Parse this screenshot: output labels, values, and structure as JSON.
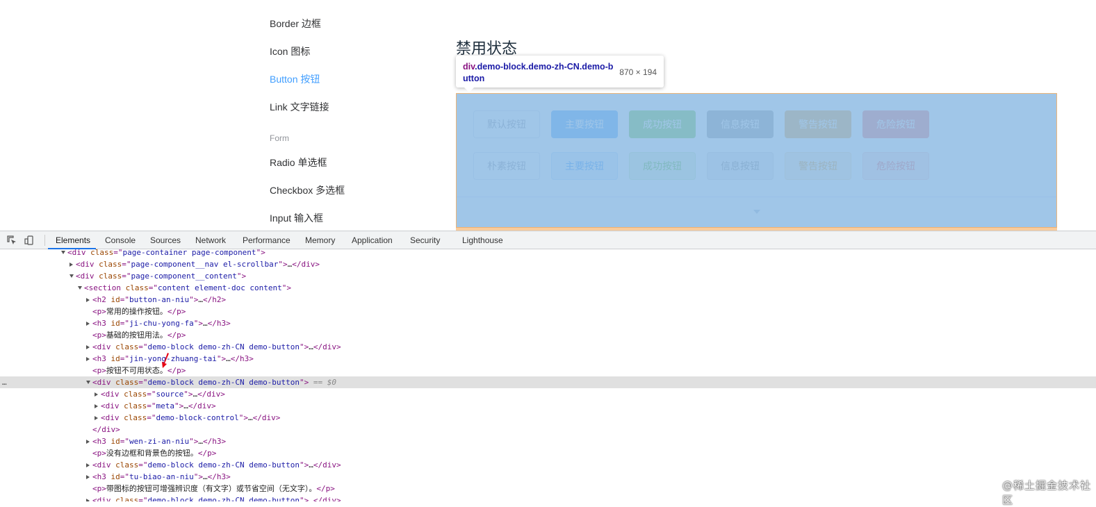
{
  "sidebar": {
    "items": [
      {
        "label": "Border 边框",
        "active": false
      },
      {
        "label": "Icon 图标",
        "active": false
      },
      {
        "label": "Button 按钮",
        "active": true
      },
      {
        "label": "Link 文字链接",
        "active": false
      }
    ],
    "group_title": "Form",
    "form_items": [
      {
        "label": "Radio 单选框"
      },
      {
        "label": "Checkbox 多选框"
      },
      {
        "label": "Input 输入框"
      }
    ]
  },
  "main": {
    "section_title": "禁用状态",
    "buttons_row1": [
      "默认按钮",
      "主要按钮",
      "成功按钮",
      "信息按钮",
      "警告按钮",
      "危险按钮"
    ],
    "buttons_row2": [
      "朴素按钮",
      "主要按钮",
      "成功按钮",
      "信息按钮",
      "警告按钮",
      "危险按钮"
    ]
  },
  "inspect_tooltip": {
    "tag": "div",
    "selector": ".demo-block.demo-zh-CN.demo-button",
    "size": "870 × 194"
  },
  "devtools": {
    "tabs": [
      "Elements",
      "Console",
      "Sources",
      "Network",
      "Performance",
      "Memory",
      "Application",
      "Security",
      "Lighthouse"
    ],
    "active_tab": "Elements",
    "dom_lines": [
      {
        "indent": 0,
        "tri": "open",
        "tag": "div",
        "attrs": [
          [
            "class",
            "page-container page-component"
          ]
        ],
        "close": false,
        "collapsed": false
      },
      {
        "indent": 1,
        "tri": "closed",
        "tag": "div",
        "attrs": [
          [
            "class",
            "page-component__nav el-scrollbar"
          ]
        ],
        "close": true,
        "collapsed": true
      },
      {
        "indent": 1,
        "tri": "open",
        "tag": "div",
        "attrs": [
          [
            "class",
            "page-component__content"
          ]
        ],
        "close": false,
        "collapsed": false
      },
      {
        "indent": 2,
        "tri": "open",
        "tag": "section",
        "attrs": [
          [
            "class",
            "content element-doc content"
          ]
        ],
        "close": false,
        "collapsed": false
      },
      {
        "indent": 3,
        "tri": "closed",
        "tag": "h2",
        "attrs": [
          [
            "id",
            "button-an-niu"
          ]
        ],
        "close": true,
        "collapsed": true
      },
      {
        "indent": 3,
        "tri": "",
        "tag": "p",
        "attrs": [],
        "text": "常用的操作按钮。",
        "close": true,
        "collapsed": false
      },
      {
        "indent": 3,
        "tri": "closed",
        "tag": "h3",
        "attrs": [
          [
            "id",
            "ji-chu-yong-fa"
          ]
        ],
        "close": true,
        "collapsed": true
      },
      {
        "indent": 3,
        "tri": "",
        "tag": "p",
        "attrs": [],
        "text": "基础的按钮用法。",
        "close": true,
        "collapsed": false
      },
      {
        "indent": 3,
        "tri": "closed",
        "tag": "div",
        "attrs": [
          [
            "class",
            "demo-block demo-zh-CN demo-button"
          ]
        ],
        "close": true,
        "collapsed": true
      },
      {
        "indent": 3,
        "tri": "closed",
        "tag": "h3",
        "attrs": [
          [
            "id",
            "jin-yong-zhuang-tai"
          ]
        ],
        "close": true,
        "collapsed": true
      },
      {
        "indent": 3,
        "tri": "",
        "tag": "p",
        "attrs": [],
        "text": "按钮不可用状态。",
        "close": true,
        "collapsed": false
      },
      {
        "indent": 3,
        "tri": "open",
        "tag": "div",
        "attrs": [
          [
            "class",
            "demo-block demo-zh-CN demo-button"
          ]
        ],
        "close": false,
        "collapsed": false,
        "selected": true,
        "suffix": " == $0"
      },
      {
        "indent": 4,
        "tri": "closed",
        "tag": "div",
        "attrs": [
          [
            "class",
            "source"
          ]
        ],
        "close": true,
        "collapsed": true
      },
      {
        "indent": 4,
        "tri": "closed",
        "tag": "div",
        "attrs": [
          [
            "class",
            "meta"
          ]
        ],
        "close": true,
        "collapsed": true
      },
      {
        "indent": 4,
        "tri": "closed",
        "tag": "div",
        "attrs": [
          [
            "class",
            "demo-block-control"
          ]
        ],
        "close": true,
        "collapsed": true
      },
      {
        "indent": 3,
        "tri": "",
        "closing": "div"
      },
      {
        "indent": 3,
        "tri": "closed",
        "tag": "h3",
        "attrs": [
          [
            "id",
            "wen-zi-an-niu"
          ]
        ],
        "close": true,
        "collapsed": true
      },
      {
        "indent": 3,
        "tri": "",
        "tag": "p",
        "attrs": [],
        "text": "没有边框和背景色的按钮。",
        "close": true,
        "collapsed": false
      },
      {
        "indent": 3,
        "tri": "closed",
        "tag": "div",
        "attrs": [
          [
            "class",
            "demo-block demo-zh-CN demo-button"
          ]
        ],
        "close": true,
        "collapsed": true
      },
      {
        "indent": 3,
        "tri": "closed",
        "tag": "h3",
        "attrs": [
          [
            "id",
            "tu-biao-an-niu"
          ]
        ],
        "close": true,
        "collapsed": true
      },
      {
        "indent": 3,
        "tri": "",
        "tag": "p",
        "attrs": [],
        "text": "带图标的按钮可增强辨识度（有文字）或节省空间（无文字）。",
        "close": true,
        "collapsed": false
      },
      {
        "indent": 3,
        "tri": "closed",
        "tag": "div",
        "attrs": [
          [
            "class",
            "demo-block demo-zh-CN demo-button"
          ]
        ],
        "close": true,
        "collapsed": true
      }
    ],
    "row_ellipsis": "…"
  },
  "watermark": "@稀土掘金技术社区",
  "colors": {
    "accent": "#409eff",
    "devtools_tab_underline": "#1a73e8",
    "highlight_content": "#6fa8dc",
    "highlight_margin": "#f6b26b"
  }
}
